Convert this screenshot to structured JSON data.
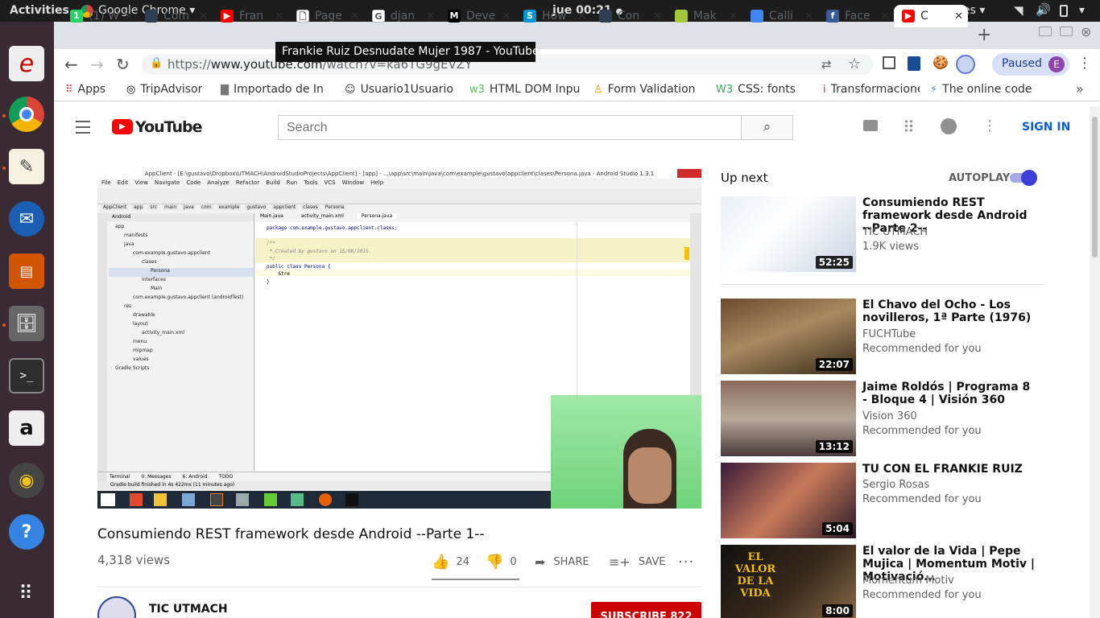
{
  "topbar": {
    "activities": "Activities",
    "app": "Google Chrome",
    "app_arrow": "▾",
    "clock": "jue 00:21",
    "clock_dot": "●",
    "lang": "es",
    "lang_arrow": "▾",
    "menu_arrow": "▾"
  },
  "tabs": [
    {
      "label": "(1) W",
      "color": "#25d366",
      "fav": "1"
    },
    {
      "label": "Cóm",
      "color": "#2c3e50",
      "fav": ""
    },
    {
      "label": "Fran",
      "color": "#ff0000",
      "fav": "▶"
    },
    {
      "label": "Page",
      "color": "#ffffff",
      "fav": "🗋"
    },
    {
      "label": "djan",
      "color": "#ffffff",
      "fav": "G"
    },
    {
      "label": "Deve",
      "color": "#000000",
      "fav": "M"
    },
    {
      "label": "How",
      "color": "#0095d5",
      "fav": "S"
    },
    {
      "label": "Con",
      "color": "#2c3e50",
      "fav": ""
    },
    {
      "label": "Mak",
      "color": "#a4c639",
      "fav": ""
    },
    {
      "label": "Calli",
      "color": "#4285f4",
      "fav": ""
    },
    {
      "label": "Face",
      "color": "#3b5998",
      "fav": "f"
    },
    {
      "label": "C",
      "color": "#ff0000",
      "fav": "▶"
    }
  ],
  "tab_new": "+",
  "tooltip": "Frankie Ruiz Desnudate Mujer 1987 - YouTube",
  "omnibox": {
    "url_prefix": "https://",
    "url_host": "www.youtube.com",
    "url_path": "/watch?v=ka6TG9gEVZY"
  },
  "profile": {
    "label": "Paused",
    "initial": "E"
  },
  "bookmarks": [
    {
      "label": "Apps",
      "icon": "⠿"
    },
    {
      "label": "TripAdvisor",
      "icon": "◎"
    },
    {
      "label": "Importado de In",
      "icon": "▇"
    },
    {
      "label": "Usuario1Usuario",
      "icon": "☺"
    },
    {
      "label": "HTML DOM Inpu",
      "icon": "w3"
    },
    {
      "label": "Form Validation",
      "icon": "♙"
    },
    {
      "label": "CSS: fonts",
      "icon": "W3"
    },
    {
      "label": "Transformacione",
      "icon": "ⅰ"
    },
    {
      "label": "The online code",
      "icon": "⚡"
    }
  ],
  "bookmarks_more": "»",
  "yt": {
    "logo": "YouTube",
    "search_placeholder": "Search",
    "signin": "SIGN IN",
    "video_title": "Consumiendo REST framework desde Android --Parte 1--",
    "views": "4,318 views",
    "likes": "24",
    "dislikes": "0",
    "share": "SHARE",
    "save": "SAVE",
    "channel": "TIC UTMACH",
    "subscribe": "SUBSCRIBE 822",
    "up_next": "Up next",
    "autoplay": "AUTOPLAY"
  },
  "ide": {
    "title": "AppClient - [E:\\gustavo\\Dropbox\\UTMACH\\AndroidStudioProjects\\AppClient] - [app] - ...\\app\\src\\main\\java\\com\\example\\gustavo\\appclient\\clases\\Persona.java - Android Studio 1.3.1",
    "menu": [
      "File",
      "Edit",
      "View",
      "Navigate",
      "Code",
      "Analyze",
      "Refactor",
      "Build",
      "Run",
      "Tools",
      "VCS",
      "Window",
      "Help"
    ],
    "breadcrumbs": [
      "AppClient",
      "app",
      "src",
      "main",
      "java",
      "com",
      "example",
      "gustavo",
      "appclient",
      "clases",
      "Persona"
    ],
    "tree": [
      "app",
      "manifests",
      "java",
      "com.example.gustavo.appclient",
      "clases",
      "Persona",
      "interfaces",
      "Main",
      "com.example.gustavo.appclient (androidTest)",
      "res",
      "drawable",
      "layout",
      "activity_main.xml",
      "menu",
      "mipmap",
      "values",
      "Gradle Scripts"
    ],
    "tabs": [
      "Main.java",
      "activity_main.xml",
      "Persona.java"
    ],
    "code": [
      "package com.example.gustavo.appclient.clases;",
      "",
      "/**",
      " * Created by gustavo on 15/08/2015.",
      " */",
      "public class Persona {",
      "    Stre",
      "}"
    ],
    "bottom_tabs": [
      "Terminal",
      "0: Messages",
      "6: Android",
      "TODO"
    ],
    "status": "Gradle build finished in 4s 422ms (11 minutes ago)",
    "android_dropdown": "Android"
  },
  "related": [
    {
      "title": "Consumiendo REST framework desde Android --Parte 2--",
      "channel": "TIC UTMACH",
      "meta": "1.9K views",
      "duration": "52:25"
    },
    {
      "title": "El Chavo del Ocho - Los novilleros, 1ª Parte (1976)",
      "channel": "FUCHTube",
      "meta": "Recommended for you",
      "duration": "22:07"
    },
    {
      "title": "Jaime Roldós | Programa 8 - Bloque 4 | Visión 360",
      "channel": "Vision 360",
      "meta": "Recommended for you",
      "duration": "13:12"
    },
    {
      "title": "TU CON EL FRANKIE RUIZ",
      "channel": "Sergio Rosas",
      "meta": "Recommended for you",
      "duration": "5:04"
    },
    {
      "title": "El valor de la Vida | Pepe Mujica | Momentum Motiv | Motivació…",
      "channel": "Momentum Motiv",
      "meta": "Recommended for you",
      "duration": "8:00",
      "thumb_text": "EL VALOR DE LA VIDA"
    }
  ]
}
